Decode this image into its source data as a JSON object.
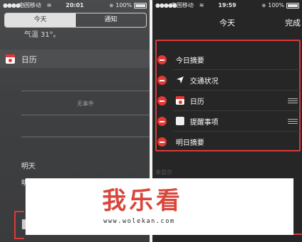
{
  "left": {
    "status": {
      "carrier": "中国移动",
      "time": "20:01",
      "battery": "100%"
    },
    "tabs": [
      {
        "label": "今天"
      },
      {
        "label": "通知"
      }
    ],
    "weather_text": "气温 31°。",
    "calendar_label": "日历",
    "no_event": "无事件",
    "tomorrow_label": "明天",
    "partial_label": "明"
  },
  "right": {
    "status": {
      "carrier": "中国移动",
      "time": "19:59",
      "battery": "100%"
    },
    "title": "今天",
    "done_label": "完成",
    "rows": [
      {
        "label": "今日摘要"
      },
      {
        "label": "交通状况"
      },
      {
        "label": "日历"
      },
      {
        "label": "提醒事项"
      },
      {
        "label": "明日摘要"
      }
    ],
    "faint_text": "未显示"
  },
  "watermark": {
    "title": "我乐看",
    "url": "www.wolekan.com"
  },
  "accent": "#d93a3a"
}
